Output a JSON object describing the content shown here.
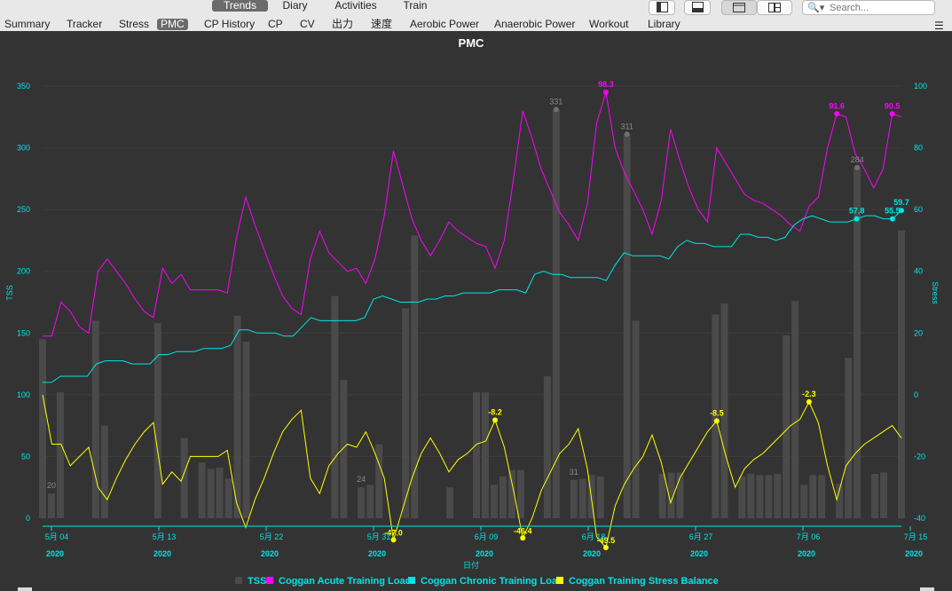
{
  "toolbar": {
    "views": [
      "Trends",
      "Diary",
      "Activities",
      "Train"
    ],
    "selected_view": "Trends",
    "search_placeholder": "Search..."
  },
  "tabs": [
    "Summary",
    "Tracker",
    "Stress",
    "PMC",
    "CP History",
    "CP",
    "CV",
    "出力",
    "速度",
    "Aerobic Power",
    "Anaerobic Power",
    "Workout",
    "Library"
  ],
  "selected_tab": "PMC",
  "chart_data": {
    "type": "bar+line",
    "title": "PMC",
    "xlabel": "日付",
    "ylabel_left": "TSS",
    "ylabel_right": "Stress",
    "y_left_ticks": [
      0,
      50,
      100,
      150,
      200,
      250,
      300,
      350
    ],
    "y_right_ticks": [
      -40,
      -20,
      0,
      20,
      40,
      60,
      80,
      100
    ],
    "ylim_left": [
      0,
      350
    ],
    "ylim_right": [
      -40,
      100
    ],
    "x_tick_labels": [
      {
        "line1": "5月 04",
        "line2": "2020"
      },
      {
        "line1": "5月 13",
        "line2": "2020"
      },
      {
        "line1": "5月 22",
        "line2": "2020"
      },
      {
        "line1": "5月 31",
        "line2": "2020"
      },
      {
        "line1": "6月 09",
        "line2": "2020"
      },
      {
        "line1": "6月 18",
        "line2": "2020"
      },
      {
        "line1": "6月 27",
        "line2": "2020"
      },
      {
        "line1": "7月 06",
        "line2": "2020"
      },
      {
        "line1": "7月 15",
        "line2": "2020"
      }
    ],
    "days": 84,
    "legend": [
      {
        "name": "TSS",
        "color": "#4a4a4a"
      },
      {
        "name": "Coggan Acute Training Load",
        "color": "#ff00ff"
      },
      {
        "name": "Coggan Chronic Training Load",
        "color": "#00e5e5"
      },
      {
        "name": "Coggan Training Stress Balance",
        "color": "#ffff00"
      }
    ],
    "series": [
      {
        "name": "TSS",
        "axis": "left",
        "values": [
          145,
          20,
          102,
          0,
          0,
          0,
          160,
          75,
          0,
          0,
          0,
          0,
          0,
          158,
          0,
          0,
          65,
          0,
          45,
          40,
          41,
          32,
          164,
          143,
          0,
          0,
          0,
          0,
          0,
          0,
          0,
          0,
          0,
          180,
          112,
          0,
          25,
          27,
          60,
          0,
          0,
          170,
          229,
          0,
          0,
          0,
          25,
          0,
          0,
          102,
          102,
          27,
          34,
          39,
          39,
          0,
          0,
          115,
          331,
          0,
          31,
          32,
          35,
          34,
          0,
          0,
          311,
          160,
          0,
          0,
          36,
          37,
          37,
          0,
          0,
          0,
          165,
          174,
          0,
          34,
          36,
          35,
          35,
          36,
          148,
          176,
          27,
          35,
          35,
          0,
          28,
          130,
          284,
          0,
          36,
          37,
          0,
          233
        ]
      },
      {
        "name": "Coggan Acute Training Load",
        "axis": "right",
        "color": "#ff00ff",
        "values": [
          19,
          19,
          30,
          27,
          22,
          20,
          40,
          44,
          40,
          36,
          31,
          27,
          25,
          41,
          36,
          39,
          34,
          34,
          34,
          34,
          33,
          51,
          64,
          55,
          47,
          39,
          32,
          28,
          26,
          44,
          53,
          46,
          43,
          40,
          41,
          36,
          44,
          58,
          79,
          68,
          57,
          50,
          45,
          50,
          56,
          53,
          51,
          49,
          48,
          41,
          50,
          70,
          92,
          83,
          73,
          66,
          59,
          55,
          50,
          62,
          88,
          98,
          80,
          72,
          66,
          60,
          52,
          63,
          86,
          76,
          67,
          60,
          56,
          80,
          75,
          70,
          65,
          63,
          62,
          60,
          58,
          55,
          53,
          61,
          64,
          80,
          91,
          90,
          78,
          73,
          67,
          73,
          91,
          90
        ]
      },
      {
        "name": "Coggan Chronic Training Load",
        "axis": "right",
        "color": "#00e5e5",
        "values": [
          4,
          4,
          6,
          6,
          6,
          6,
          10,
          11,
          11,
          11,
          10,
          10,
          10,
          13,
          13,
          14,
          14,
          14,
          15,
          15,
          15,
          16,
          21,
          21,
          20,
          20,
          20,
          19,
          19,
          22,
          25,
          24,
          24,
          24,
          24,
          24,
          25,
          31,
          32,
          31,
          30,
          30,
          30,
          31,
          31,
          32,
          32,
          33,
          33,
          33,
          33,
          34,
          34,
          34,
          33,
          39,
          40,
          39,
          39,
          38,
          38,
          38,
          38,
          37,
          42,
          46,
          45,
          45,
          45,
          45,
          44,
          48,
          50,
          49,
          49,
          48,
          48,
          48,
          52,
          52,
          51,
          51,
          50,
          51,
          55,
          57,
          58,
          57,
          56,
          56,
          56,
          57,
          58,
          58,
          57,
          57,
          59.7
        ]
      },
      {
        "name": "Coggan Training Stress Balance",
        "axis": "right",
        "color": "#ffff00",
        "values": [
          0,
          -16,
          -16,
          -23,
          -20,
          -17,
          -30,
          -34,
          -27,
          -21,
          -16,
          -12,
          -9,
          -29,
          -25,
          -28,
          -20,
          -20,
          -20,
          -20,
          -18,
          -35,
          -43,
          -34,
          -27,
          -19,
          -12,
          -8,
          -5,
          -27,
          -32,
          -23,
          -19,
          -16,
          -17,
          -12,
          -19,
          -27,
          -47,
          -37,
          -27,
          -19,
          -14,
          -19,
          -25,
          -21,
          -19,
          -16,
          -15,
          -8.2,
          -17,
          -31,
          -46.4,
          -40,
          -31,
          -25,
          -19,
          -16,
          -11,
          -24,
          -46,
          -49.5,
          -36,
          -29,
          -24,
          -20,
          -13,
          -22,
          -35,
          -27,
          -22,
          -17,
          -12,
          -8.5,
          -20,
          -30,
          -24,
          -21,
          -19,
          -16,
          -13,
          -10,
          -8,
          -2.3,
          -9,
          -23,
          -34,
          -23,
          -19,
          -16,
          -14,
          -12,
          -10,
          -14
        ]
      }
    ],
    "annotations": {
      "tss": [
        {
          "i": 1,
          "label": "20"
        },
        {
          "i": 36,
          "label": "24"
        },
        {
          "i": 58,
          "label": "331"
        },
        {
          "i": 60,
          "label": "31"
        },
        {
          "i": 66,
          "label": "311"
        },
        {
          "i": 92,
          "label": "284"
        }
      ],
      "ctl": [
        {
          "label": "57.8"
        },
        {
          "label": "55.5"
        },
        {
          "label": "59.7"
        }
      ],
      "atl": [
        {
          "label": "98.3"
        },
        {
          "label": "91.6"
        },
        {
          "label": "90.5"
        }
      ],
      "tsb": [
        {
          "label": "-47.0"
        },
        {
          "label": "-8.2"
        },
        {
          "label": "-46.4"
        },
        {
          "label": "-49.5"
        },
        {
          "label": "-8.5"
        },
        {
          "label": "-2.3"
        }
      ]
    }
  }
}
